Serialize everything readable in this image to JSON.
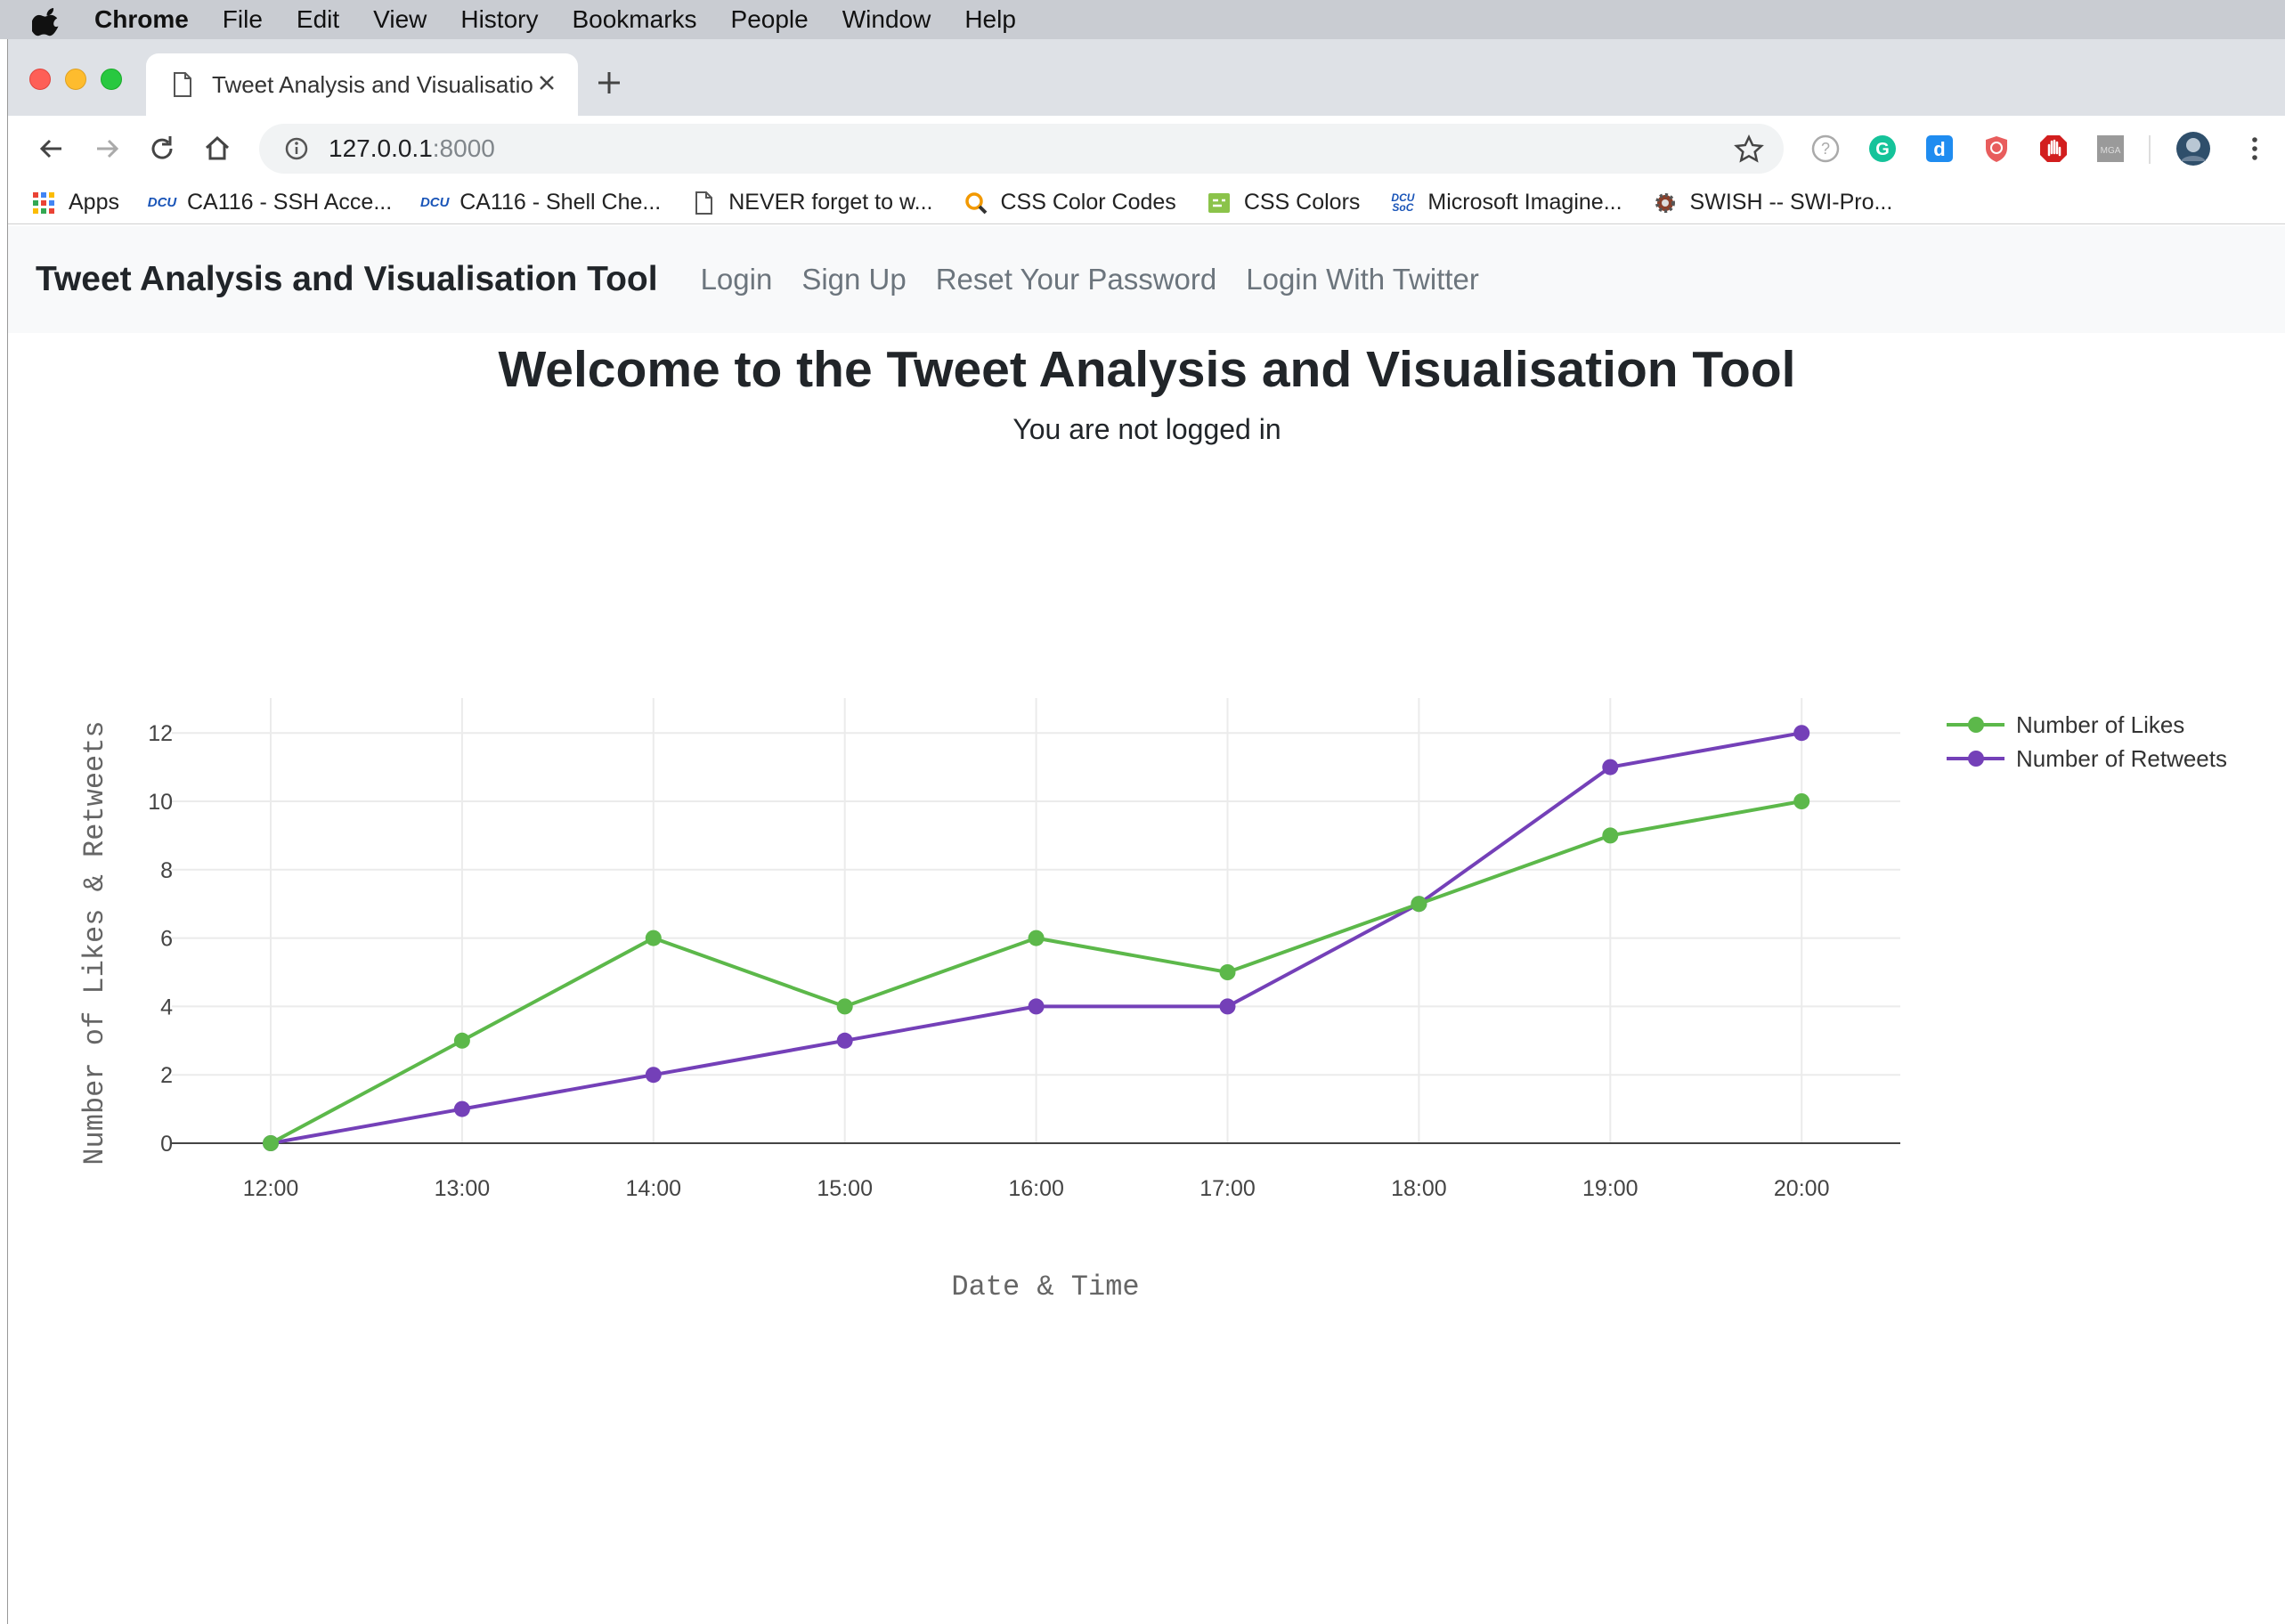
{
  "menubar": {
    "app": "Chrome",
    "items": [
      "File",
      "Edit",
      "View",
      "History",
      "Bookmarks",
      "People",
      "Window",
      "Help"
    ]
  },
  "tab": {
    "title": "Tweet Analysis and Visualisation Tool"
  },
  "omnibox": {
    "host": "127.0.0.1",
    "port": ":8000"
  },
  "bookmarks": [
    {
      "label": "Apps",
      "icon": "apps-grid-icon"
    },
    {
      "label": "CA116 - SSH Acce...",
      "icon": "dcu-icon"
    },
    {
      "label": "CA116 - Shell Che...",
      "icon": "dcu-icon"
    },
    {
      "label": "NEVER forget to w...",
      "icon": "document-icon"
    },
    {
      "label": "CSS Color Codes",
      "icon": "magnifier-icon"
    },
    {
      "label": "CSS Colors",
      "icon": "css-icon"
    },
    {
      "label": "Microsoft Imagine...",
      "icon": "dcu-soc-icon"
    },
    {
      "label": "SWISH -- SWI-Pro...",
      "icon": "gear-icon"
    }
  ],
  "navbar": {
    "brand": "Tweet Analysis and Visualisation Tool",
    "links": [
      "Login",
      "Sign Up",
      "Reset Your Password",
      "Login With Twitter"
    ]
  },
  "main": {
    "heading": "Welcome to the Tweet Analysis and Visualisation Tool",
    "status": "You are not logged in"
  },
  "chart_data": {
    "type": "line",
    "x": [
      "12:00",
      "13:00",
      "14:00",
      "15:00",
      "16:00",
      "17:00",
      "18:00",
      "19:00",
      "20:00"
    ],
    "series": [
      {
        "name": "Number of Likes",
        "color": "#5cb84a",
        "values": [
          0,
          3,
          6,
          4,
          6,
          5,
          7,
          9,
          10
        ]
      },
      {
        "name": "Number of Retweets",
        "color": "#7440b8",
        "values": [
          0,
          1,
          2,
          3,
          4,
          4,
          7,
          11,
          12
        ]
      }
    ],
    "xlabel": "Date & Time",
    "ylabel": "Number of Likes & Retweets",
    "yticks": [
      0,
      2,
      4,
      6,
      8,
      10,
      12
    ],
    "grid": true,
    "legend": "top-right"
  }
}
